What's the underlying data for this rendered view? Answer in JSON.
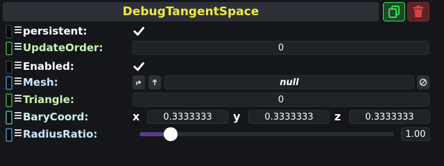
{
  "header": {
    "title": "DebugTangentSpace"
  },
  "colors": {
    "title": "#f3ea3f",
    "label_white": "#ffffff",
    "label_green": "#c9f5b0",
    "label_blue": "#cfe6ff",
    "field_bg": "#1f2227",
    "duplicate": "#3fdc5a",
    "delete": "#d9414a",
    "slider_fill": "#5a3a8a"
  },
  "fields": {
    "persistent": {
      "label": "persistent:",
      "value": true
    },
    "update_order": {
      "label": "UpdateOrder:",
      "value": "0"
    },
    "enabled": {
      "label": "Enabled:",
      "value": true
    },
    "mesh": {
      "label": "Mesh:",
      "value": "null"
    },
    "triangle": {
      "label": "Triangle:",
      "value": "0"
    },
    "bary_coord": {
      "label": "BaryCoord:",
      "x_label": "x",
      "x": "0.3333333",
      "y_label": "y",
      "y": "0.3333333",
      "z_label": "z",
      "z": "0.3333333"
    },
    "radius_ratio": {
      "label": "RadiusRatio:",
      "value": "1.00",
      "slider_fraction": 0.09
    }
  },
  "icons": {
    "duplicate": "duplicate-icon",
    "delete": "trash-icon",
    "check": "check-icon",
    "grip": "grip-icon",
    "clear": "null-icon"
  }
}
